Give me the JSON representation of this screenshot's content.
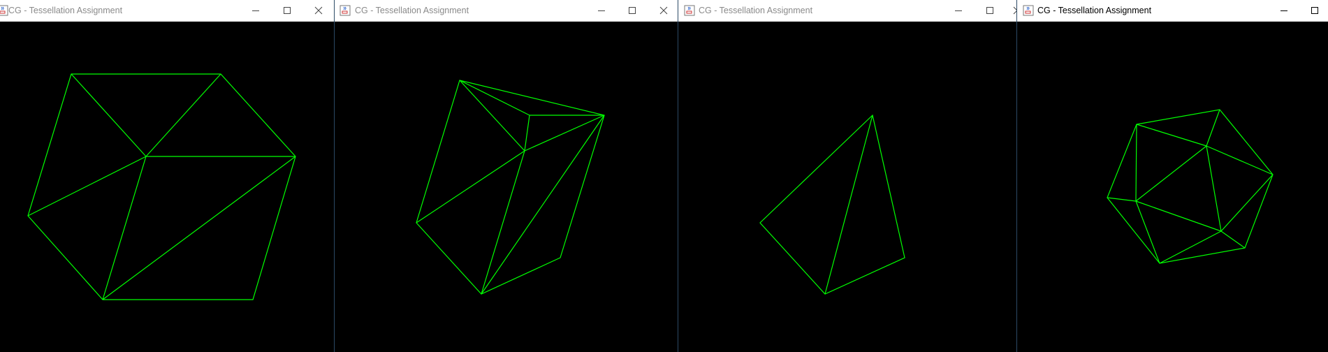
{
  "windows": [
    {
      "title": "CG - Tessellation Assignment",
      "active": false,
      "icon": "java-cup-icon"
    },
    {
      "title": "CG - Tessellation Assignment",
      "active": false,
      "icon": "java-cup-icon"
    },
    {
      "title": "CG - Tessellation Assignment",
      "active": false,
      "icon": "java-cup-icon"
    },
    {
      "title": "CG - Tessellation Assignment",
      "active": true,
      "icon": "java-cup-icon"
    }
  ],
  "colors": {
    "line": "#00ff00",
    "canvas": "#000000",
    "titlebar": "#ffffff",
    "border": "#2c4a66"
  }
}
